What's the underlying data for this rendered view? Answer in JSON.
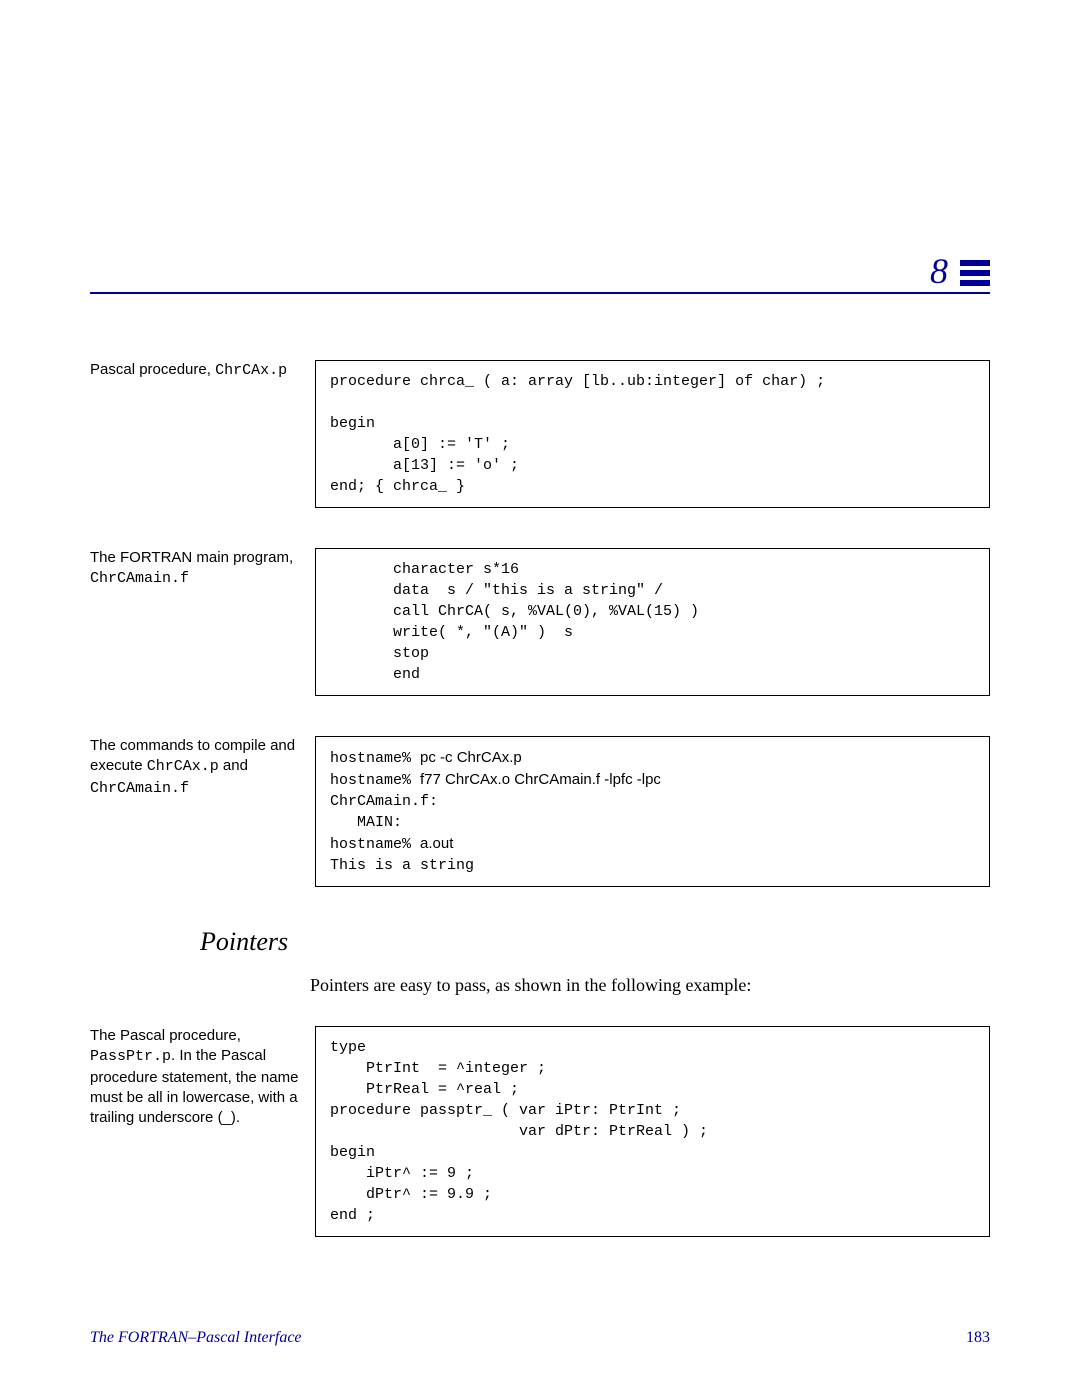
{
  "chapter_number": "8",
  "labels": {
    "row1_a": "Pascal procedure, ",
    "row1_b": "ChrCAx.p",
    "row2_a": "The FORTRAN main program, ",
    "row2_b": "ChrCAmain.f",
    "row3_a": "The commands to compile and execute ",
    "row3_b": "ChrCAx.p",
    "row3_c": " and ",
    "row3_d": "ChrCAmain.f",
    "row4_a": "The Pascal procedure, ",
    "row4_b": "PassPtr.p",
    "row4_c": ". In the Pascal procedure statement, the name must be all in lowercase, with a trailing underscore (_)."
  },
  "code": {
    "box1": "procedure chrca_ ( a: array [lb..ub:integer] of char) ;\n\nbegin\n       a[0] := 'T' ;\n       a[13] := 'o' ;\nend; { chrca_ }",
    "box2": "       character s*16\n       data  s / \"this is a string\" /\n       call ChrCA( s, %VAL(0), %VAL(15) )\n       write( *, \"(A)\" )  s\n       stop\n       end",
    "box3_l1a": "hostname% ",
    "box3_l1b": "pc -c ChrCAx.p",
    "box3_l2a": "hostname% ",
    "box3_l2b": "f77 ChrCAx.o ChrCAmain.f -lpfc -lpc",
    "box3_l3": "ChrCAmain.f:",
    "box3_l4": "   MAIN:",
    "box3_l5a": "hostname% ",
    "box3_l5b": "a.out",
    "box3_l6": "This is a string",
    "box4": "type\n    PtrInt  = ^integer ;\n    PtrReal = ^real ;\nprocedure passptr_ ( var iPtr: PtrInt ;\n                     var dPtr: PtrReal ) ;\nbegin\n    iPtr^ := 9 ;\n    dPtr^ := 9.9 ;\nend ;"
  },
  "section_heading": "Pointers",
  "body_text": "Pointers are easy to pass, as shown in the following example:",
  "footer": {
    "title": "The FORTRAN–Pascal Interface",
    "page": "183"
  }
}
